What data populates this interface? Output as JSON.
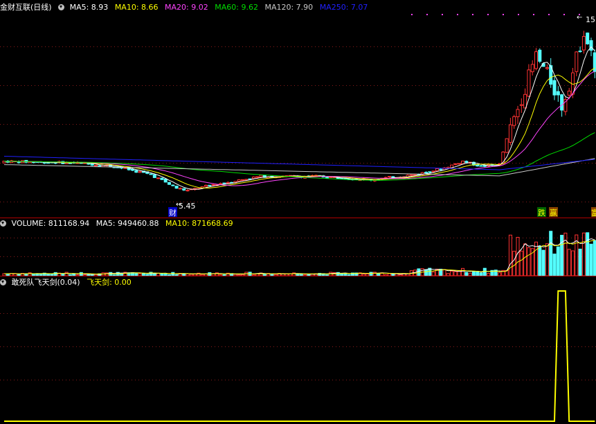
{
  "main_header": {
    "title": "金财互联(日线)",
    "indicators": [
      {
        "label": "MA5: 8.93",
        "color": "#ffffff"
      },
      {
        "label": "MA10: 8.66",
        "color": "#ffff00"
      },
      {
        "label": "MA20: 9.02",
        "color": "#ff44ff"
      },
      {
        "label": "MA60: 9.62",
        "color": "#00dd00"
      },
      {
        "label": "MA120: 7.90",
        "color": "#c8c8c8"
      },
      {
        "label": "MA250: 7.07",
        "color": "#2020ff"
      }
    ]
  },
  "volume_header": {
    "label": "VOLUME: 811168.94",
    "ma5": "MA5: 949460.88",
    "ma10": "MA10: 871668.69"
  },
  "indicator_header": {
    "label": "敢死队飞天剑(0.04)",
    "value": "飞天剑: 0.00"
  },
  "annotations": {
    "low_price": "5.45",
    "high_price": "15",
    "marker_cai": "财",
    "marker_die": "跌",
    "marker_ying": "赢",
    "marker_right": "富"
  },
  "colors": {
    "up": "#ff3232",
    "down": "#54ffff",
    "grid": "#8b1a1a",
    "separator": "#b00000"
  },
  "chart_data": [
    {
      "type": "candlestick",
      "title": "金财互联(日线)",
      "note": "daily price chart; values estimated from the picture",
      "ylim": [
        4.5,
        16
      ],
      "lines": [
        {
          "name": "MA5",
          "color": "#ffffff"
        },
        {
          "name": "MA10",
          "color": "#ffff00"
        },
        {
          "name": "MA20",
          "color": "#ff44ff"
        },
        {
          "name": "MA60",
          "color": "#00dd00"
        },
        {
          "name": "MA120",
          "color": "#c8c8c8"
        },
        {
          "name": "MA250",
          "color": "#2020ff"
        }
      ]
    },
    {
      "type": "bar",
      "title": "VOLUME",
      "latest": 811168.94
    },
    {
      "type": "line",
      "title": "飞天剑",
      "latest": 0.0,
      "ylim": [
        0,
        1
      ],
      "signal_bars": [
        151,
        152,
        153
      ]
    }
  ]
}
